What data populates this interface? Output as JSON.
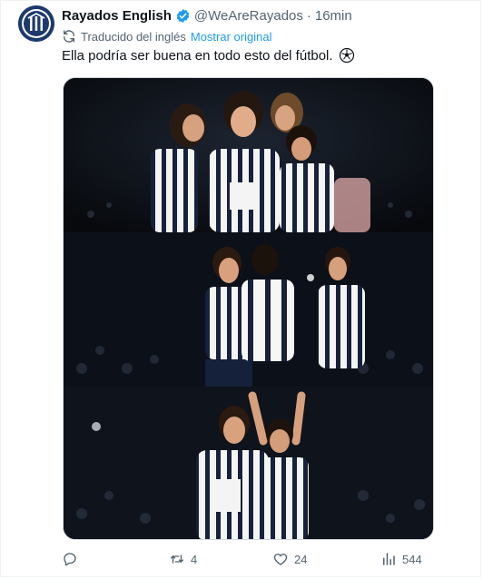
{
  "tweet": {
    "display_name": "Rayados English",
    "handle": "@WeAreRayados",
    "separator": "·",
    "time": "16min",
    "translated_label": "Traducido del inglés",
    "show_original_label": "Mostrar original",
    "text": "Ella podría ser buena en todo esto del fútbol.",
    "text_icon": "soccer-ball-icon",
    "media_images": 3
  },
  "actions": {
    "reply_count": "",
    "retweet_count": "4",
    "like_count": "24",
    "views_count": "544"
  },
  "colors": {
    "text_primary": "#0f1419",
    "text_secondary": "#536471",
    "link_blue": "#1d9bf0",
    "verified_blue": "#1d9bf0",
    "avatar_bg": "#1d3a6e"
  }
}
